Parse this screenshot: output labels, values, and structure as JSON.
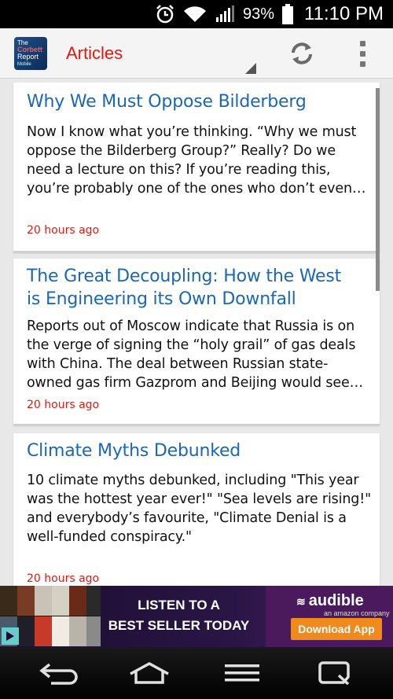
{
  "status_bar": {
    "battery_percent": "93%",
    "time": "11:10 PM",
    "icons": [
      "alarm-icon",
      "wifi-icon",
      "signal-icon",
      "battery-icon"
    ]
  },
  "action_bar": {
    "logo": {
      "line1": "The",
      "line2": "Corbett",
      "line3": "Report",
      "line4": "Mobile"
    },
    "title": "Articles",
    "accent_color": "#e3180f"
  },
  "articles": [
    {
      "title_lines": [
        "Why We Must Oppose Bilderberg"
      ],
      "excerpt_lines": [
        "Now I know what you’re thinking. “Why we must",
        "oppose the Bilderberg Group?” Really? Do we",
        "need a lecture on this? If you’re reading this,",
        "you’re probably one of the ones who don’t even…"
      ],
      "time": "20 hours ago"
    },
    {
      "title_lines": [
        "The Great Decoupling: How the West",
        "is Engineering its Own Downfall"
      ],
      "excerpt_lines": [
        "Reports out of Moscow indicate that Russia is on",
        "the verge of signing the “holy grail” of gas deals",
        "with China. The deal between Russian state-",
        "owned gas firm Gazprom and Beijing would see…"
      ],
      "time": "20 hours ago"
    },
    {
      "title_lines": [
        "Climate Myths Debunked"
      ],
      "excerpt_lines": [
        "10 climate myths debunked, including \"This year",
        "was the hottest year ever!\" \"Sea levels are rising!\"",
        "and everybody’s favourite, \"Climate Denial is a",
        "well-funded conspiracy.\""
      ],
      "time": "20 hours ago"
    }
  ],
  "ad": {
    "headline_1": "LISTEN TO A",
    "headline_2": "BEST SELLER TODAY",
    "brand": "audible",
    "brand_sub": "an amazon company",
    "cta": "Download App"
  },
  "nav_bar": {
    "buttons": [
      "back-icon",
      "home-icon",
      "menu-icon",
      "recent-apps-icon"
    ]
  }
}
